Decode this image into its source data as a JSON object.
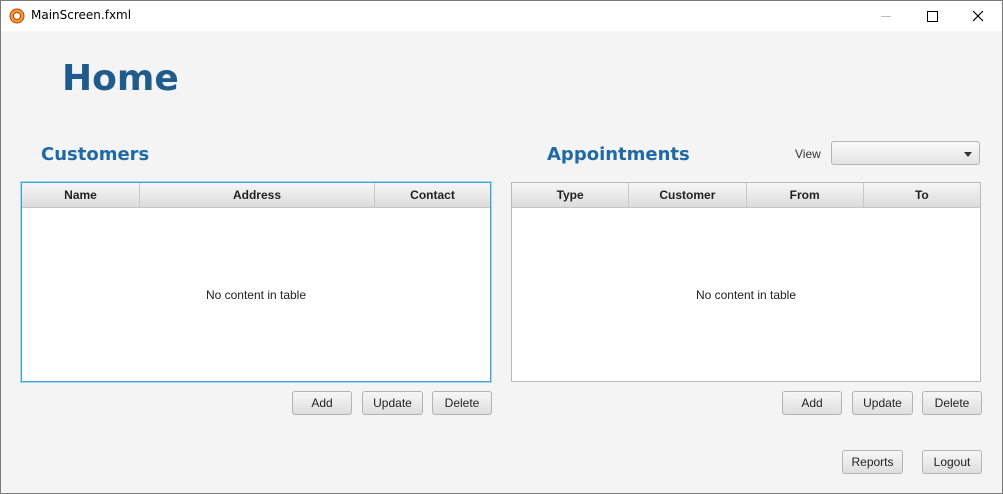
{
  "window": {
    "title": "MainScreen.fxml",
    "icon": "java-app-icon",
    "controls": {
      "minimize": "minimize-icon",
      "maximize": "maximize-icon",
      "close": "close-icon"
    }
  },
  "page": {
    "title": "Home"
  },
  "customers": {
    "title": "Customers",
    "columns": [
      "Name",
      "Address",
      "Contact"
    ],
    "empty_text": "No content in table",
    "buttons": {
      "add": "Add",
      "update": "Update",
      "delete": "Delete"
    }
  },
  "appointments": {
    "title": "Appointments",
    "view_label": "View",
    "view_selected": "",
    "columns": [
      "Type",
      "Customer",
      "From",
      "To"
    ],
    "empty_text": "No content in table",
    "buttons": {
      "add": "Add",
      "update": "Update",
      "delete": "Delete"
    }
  },
  "footer": {
    "reports": "Reports",
    "logout": "Logout"
  },
  "colors": {
    "heading": "#1f5c8c",
    "section": "#1f6aa5",
    "focus": "#3ca5d8",
    "background": "#f4f4f4"
  }
}
